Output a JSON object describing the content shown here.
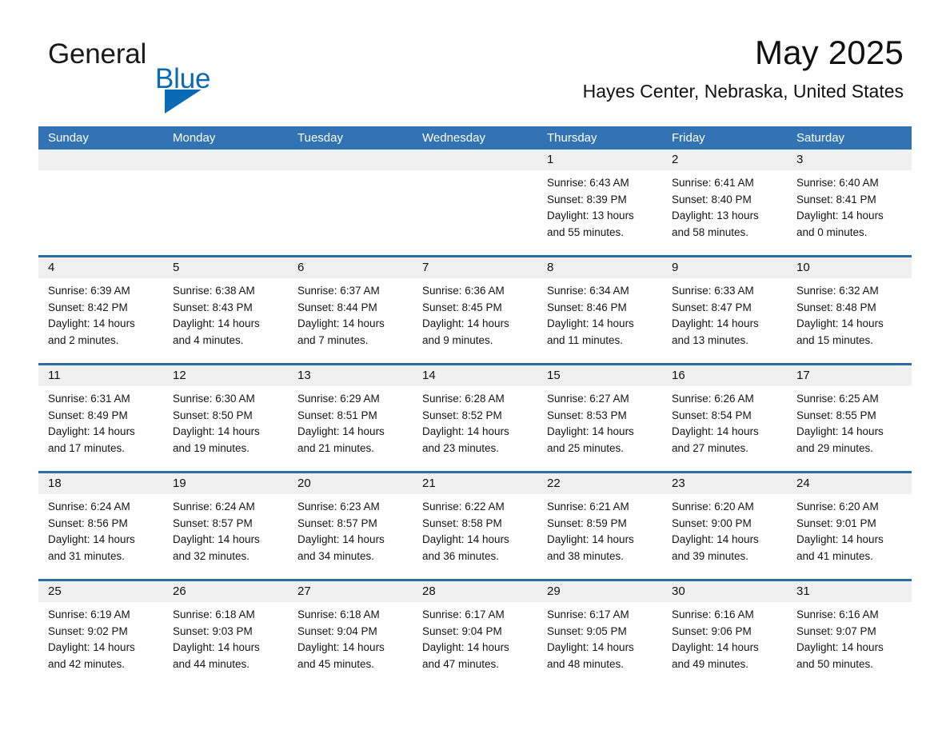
{
  "brand": {
    "name_part1": "General",
    "name_part2": "Blue",
    "accent_color": "#0a6ab5"
  },
  "header": {
    "title": "May 2025",
    "subtitle": "Hayes Center, Nebraska, United States",
    "header_bg_color": "#3173b3",
    "daynum_band_color": "#f0f0f0",
    "row_divider_color": "#2e6da4"
  },
  "weekdays": [
    "Sunday",
    "Monday",
    "Tuesday",
    "Wednesday",
    "Thursday",
    "Friday",
    "Saturday"
  ],
  "weeks": [
    [
      {
        "day": "",
        "lines": []
      },
      {
        "day": "",
        "lines": []
      },
      {
        "day": "",
        "lines": []
      },
      {
        "day": "",
        "lines": []
      },
      {
        "day": "1",
        "lines": [
          "Sunrise: 6:43 AM",
          "Sunset: 8:39 PM",
          "Daylight: 13 hours",
          "and 55 minutes."
        ]
      },
      {
        "day": "2",
        "lines": [
          "Sunrise: 6:41 AM",
          "Sunset: 8:40 PM",
          "Daylight: 13 hours",
          "and 58 minutes."
        ]
      },
      {
        "day": "3",
        "lines": [
          "Sunrise: 6:40 AM",
          "Sunset: 8:41 PM",
          "Daylight: 14 hours",
          "and 0 minutes."
        ]
      }
    ],
    [
      {
        "day": "4",
        "lines": [
          "Sunrise: 6:39 AM",
          "Sunset: 8:42 PM",
          "Daylight: 14 hours",
          "and 2 minutes."
        ]
      },
      {
        "day": "5",
        "lines": [
          "Sunrise: 6:38 AM",
          "Sunset: 8:43 PM",
          "Daylight: 14 hours",
          "and 4 minutes."
        ]
      },
      {
        "day": "6",
        "lines": [
          "Sunrise: 6:37 AM",
          "Sunset: 8:44 PM",
          "Daylight: 14 hours",
          "and 7 minutes."
        ]
      },
      {
        "day": "7",
        "lines": [
          "Sunrise: 6:36 AM",
          "Sunset: 8:45 PM",
          "Daylight: 14 hours",
          "and 9 minutes."
        ]
      },
      {
        "day": "8",
        "lines": [
          "Sunrise: 6:34 AM",
          "Sunset: 8:46 PM",
          "Daylight: 14 hours",
          "and 11 minutes."
        ]
      },
      {
        "day": "9",
        "lines": [
          "Sunrise: 6:33 AM",
          "Sunset: 8:47 PM",
          "Daylight: 14 hours",
          "and 13 minutes."
        ]
      },
      {
        "day": "10",
        "lines": [
          "Sunrise: 6:32 AM",
          "Sunset: 8:48 PM",
          "Daylight: 14 hours",
          "and 15 minutes."
        ]
      }
    ],
    [
      {
        "day": "11",
        "lines": [
          "Sunrise: 6:31 AM",
          "Sunset: 8:49 PM",
          "Daylight: 14 hours",
          "and 17 minutes."
        ]
      },
      {
        "day": "12",
        "lines": [
          "Sunrise: 6:30 AM",
          "Sunset: 8:50 PM",
          "Daylight: 14 hours",
          "and 19 minutes."
        ]
      },
      {
        "day": "13",
        "lines": [
          "Sunrise: 6:29 AM",
          "Sunset: 8:51 PM",
          "Daylight: 14 hours",
          "and 21 minutes."
        ]
      },
      {
        "day": "14",
        "lines": [
          "Sunrise: 6:28 AM",
          "Sunset: 8:52 PM",
          "Daylight: 14 hours",
          "and 23 minutes."
        ]
      },
      {
        "day": "15",
        "lines": [
          "Sunrise: 6:27 AM",
          "Sunset: 8:53 PM",
          "Daylight: 14 hours",
          "and 25 minutes."
        ]
      },
      {
        "day": "16",
        "lines": [
          "Sunrise: 6:26 AM",
          "Sunset: 8:54 PM",
          "Daylight: 14 hours",
          "and 27 minutes."
        ]
      },
      {
        "day": "17",
        "lines": [
          "Sunrise: 6:25 AM",
          "Sunset: 8:55 PM",
          "Daylight: 14 hours",
          "and 29 minutes."
        ]
      }
    ],
    [
      {
        "day": "18",
        "lines": [
          "Sunrise: 6:24 AM",
          "Sunset: 8:56 PM",
          "Daylight: 14 hours",
          "and 31 minutes."
        ]
      },
      {
        "day": "19",
        "lines": [
          "Sunrise: 6:24 AM",
          "Sunset: 8:57 PM",
          "Daylight: 14 hours",
          "and 32 minutes."
        ]
      },
      {
        "day": "20",
        "lines": [
          "Sunrise: 6:23 AM",
          "Sunset: 8:57 PM",
          "Daylight: 14 hours",
          "and 34 minutes."
        ]
      },
      {
        "day": "21",
        "lines": [
          "Sunrise: 6:22 AM",
          "Sunset: 8:58 PM",
          "Daylight: 14 hours",
          "and 36 minutes."
        ]
      },
      {
        "day": "22",
        "lines": [
          "Sunrise: 6:21 AM",
          "Sunset: 8:59 PM",
          "Daylight: 14 hours",
          "and 38 minutes."
        ]
      },
      {
        "day": "23",
        "lines": [
          "Sunrise: 6:20 AM",
          "Sunset: 9:00 PM",
          "Daylight: 14 hours",
          "and 39 minutes."
        ]
      },
      {
        "day": "24",
        "lines": [
          "Sunrise: 6:20 AM",
          "Sunset: 9:01 PM",
          "Daylight: 14 hours",
          "and 41 minutes."
        ]
      }
    ],
    [
      {
        "day": "25",
        "lines": [
          "Sunrise: 6:19 AM",
          "Sunset: 9:02 PM",
          "Daylight: 14 hours",
          "and 42 minutes."
        ]
      },
      {
        "day": "26",
        "lines": [
          "Sunrise: 6:18 AM",
          "Sunset: 9:03 PM",
          "Daylight: 14 hours",
          "and 44 minutes."
        ]
      },
      {
        "day": "27",
        "lines": [
          "Sunrise: 6:18 AM",
          "Sunset: 9:04 PM",
          "Daylight: 14 hours",
          "and 45 minutes."
        ]
      },
      {
        "day": "28",
        "lines": [
          "Sunrise: 6:17 AM",
          "Sunset: 9:04 PM",
          "Daylight: 14 hours",
          "and 47 minutes."
        ]
      },
      {
        "day": "29",
        "lines": [
          "Sunrise: 6:17 AM",
          "Sunset: 9:05 PM",
          "Daylight: 14 hours",
          "and 48 minutes."
        ]
      },
      {
        "day": "30",
        "lines": [
          "Sunrise: 6:16 AM",
          "Sunset: 9:06 PM",
          "Daylight: 14 hours",
          "and 49 minutes."
        ]
      },
      {
        "day": "31",
        "lines": [
          "Sunrise: 6:16 AM",
          "Sunset: 9:07 PM",
          "Daylight: 14 hours",
          "and 50 minutes."
        ]
      }
    ]
  ]
}
